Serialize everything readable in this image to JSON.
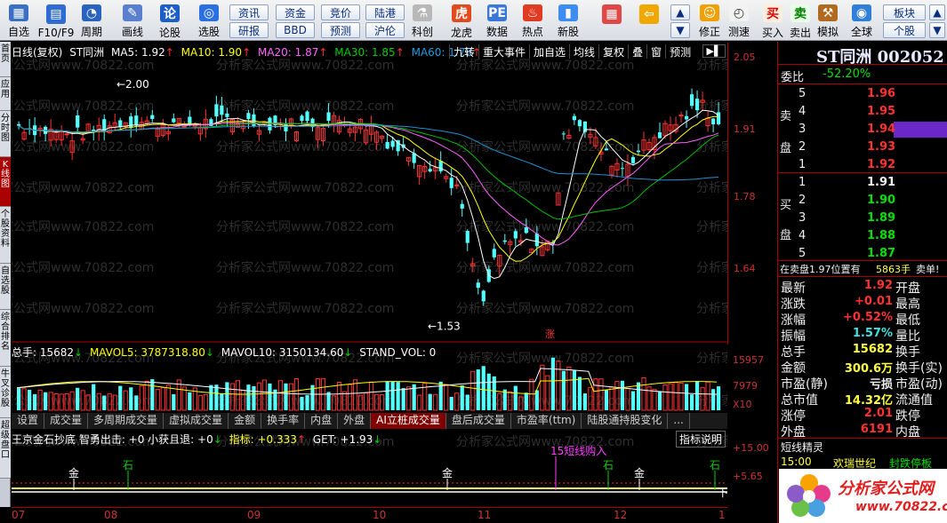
{
  "toolbar": {
    "left_items": [
      {
        "label": "自选",
        "icon": "grid-icon"
      },
      {
        "label": "F10/F9",
        "icon": "table-icon"
      },
      {
        "label": "周期",
        "icon": "clock-icon"
      },
      {
        "label": "画线",
        "icon": "pencil-icon"
      },
      {
        "label": "论股",
        "icon": "discuss-icon"
      },
      {
        "label": "选股",
        "icon": "compass-icon"
      }
    ],
    "text_buttons": [
      [
        "资讯",
        "研报"
      ],
      [
        "资金",
        "BBD"
      ],
      [
        "竞价",
        "预测"
      ],
      [
        "陆港",
        "沪伦"
      ]
    ],
    "mid_items": [
      {
        "label": "科创",
        "icon": "science-icon"
      },
      {
        "label": "龙虎",
        "icon": "tiger-icon"
      },
      {
        "label": "数据",
        "icon": "pe-icon"
      },
      {
        "label": "热点",
        "icon": "hot-icon"
      },
      {
        "label": "新股",
        "icon": "new-stock-icon"
      }
    ],
    "right_items": [
      {
        "label": "",
        "icon": "tiles-icon"
      },
      {
        "label": "",
        "icon": "back-arrow-icon"
      },
      {
        "label": "修正",
        "icon": "smile-icon"
      },
      {
        "label": "测速",
        "icon": "speed-clock-icon"
      },
      {
        "label": "买入",
        "icon": "buy-icon",
        "glyph": "买"
      },
      {
        "label": "卖出",
        "icon": "sell-icon",
        "glyph": "卖"
      },
      {
        "label": "模拟",
        "icon": "hammer-icon"
      },
      {
        "label": "全球",
        "icon": "globe-icon"
      }
    ],
    "far_right": [
      [
        "板块",
        "个股"
      ]
    ]
  },
  "left_tabs": [
    "首页",
    "应用",
    "分时图",
    "K线图",
    "个股资料",
    "自选股",
    "综合排名",
    "牛叉诊股",
    "超级盘口"
  ],
  "chart": {
    "header": {
      "period": "日线(复权)",
      "name": "ST同洲",
      "ma5": "MA5: 1.92",
      "ma10": "MA10: 1.90",
      "ma20": "MA20: 1.87",
      "ma30": "MA30: 1.85",
      "ma60": "MA60: 1.78"
    },
    "tools": [
      "九转",
      "重大事件",
      "加自选",
      "均线",
      "复权",
      "叠",
      "窗",
      "预测"
    ],
    "price_ticks": [
      "2.05",
      "1.91",
      "1.78",
      "1.64"
    ],
    "high_label": "2.00",
    "low_label": "1.53",
    "zhang_label": "涨",
    "watermark": "分析家公式网www.70822.com"
  },
  "volume": {
    "total": "总手: 15682",
    "mavol5": "MAVOL5: 3787318.80",
    "mavol10": "MAVOL10: 3150134.60",
    "stand": "STAND_VOL: 0",
    "ticks": [
      "15957",
      "7979",
      "X10"
    ]
  },
  "subtabs": [
    "设置",
    "成交量",
    "多周期成交量",
    "虚拟成交量",
    "金额",
    "换手率",
    "内盘",
    "外盘",
    "AI立桩成交量",
    "盘后成交量",
    "市盈率(ttm)",
    "陆股通持股变化",
    "..."
  ],
  "indicator": {
    "header": "王京金石抄底 智勇出击: +0 小获且退: +0",
    "zhibiao": "指标: +0.333",
    "get": "GET: +1.93",
    "help": "指标说明",
    "ticks": [
      "+15.00",
      "+5.65"
    ],
    "signals": [
      {
        "text": "金",
        "color": "#ffffff"
      },
      {
        "text": "石",
        "color": "#00d000"
      },
      {
        "text": "金",
        "color": "#ffffff"
      },
      {
        "text": "15短线购入",
        "color": "#ff40ff"
      },
      {
        "text": "石",
        "color": "#00d000"
      },
      {
        "text": "金",
        "color": "#ffffff"
      },
      {
        "text": "石",
        "color": "#00d000"
      }
    ],
    "right_label": "下"
  },
  "dates": [
    "07",
    "08",
    "09",
    "10",
    "11",
    "12",
    "1"
  ],
  "right_panel": {
    "title": "ST同洲 002052",
    "weibi_label": "委比",
    "weibi_value": "-52.20%",
    "sell_label_top": "卖",
    "sell_label_bottom": "盘",
    "buy_label_top": "买",
    "buy_label_bottom": "盘",
    "asks": [
      {
        "level": "5",
        "price": "1.96"
      },
      {
        "level": "4",
        "price": "1.95"
      },
      {
        "level": "3",
        "price": "1.94"
      },
      {
        "level": "2",
        "price": "1.93"
      },
      {
        "level": "1",
        "price": "1.92"
      }
    ],
    "bids": [
      {
        "level": "1",
        "price": "1.91"
      },
      {
        "level": "2",
        "price": "1.90"
      },
      {
        "level": "3",
        "price": "1.89"
      },
      {
        "level": "4",
        "price": "1.88"
      },
      {
        "level": "5",
        "price": "1.87"
      }
    ],
    "sell_status": "在卖盘1.97位置有",
    "sell_qty": "5863手",
    "sell_tag": "卖单!",
    "stats": [
      {
        "l1": "最新",
        "v1": "1.92",
        "c1": "r",
        "l2": "开盘"
      },
      {
        "l1": "涨跌",
        "v1": "+0.01",
        "c1": "r",
        "l2": "最高"
      },
      {
        "l1": "涨幅",
        "v1": "+0.52%",
        "c1": "r",
        "l2": "最低"
      },
      {
        "l1": "振幅",
        "v1": "1.57%",
        "c1": "c",
        "l2": "量比"
      },
      {
        "l1": "总手",
        "v1": "15682",
        "c1": "y",
        "l2": "换手"
      },
      {
        "l1": "金额",
        "v1": "300.6万",
        "c1": "y",
        "l2": "换手(实)"
      },
      {
        "l1": "市盈(静)",
        "v1": "亏损",
        "c1": "w",
        "l2": "市盈(动)"
      },
      {
        "l1": "总市值",
        "v1": "14.32亿",
        "c1": "y",
        "l2": "流通值"
      },
      {
        "l1": "涨停",
        "v1": "2.01",
        "c1": "r",
        "l2": "跌停"
      },
      {
        "l1": "外盘",
        "v1": "6191",
        "c1": "r",
        "l2": "内盘"
      }
    ],
    "elf_title": "短线精灵",
    "elf_time": "15:00",
    "elf_name": "欢瑞世纪",
    "elf_event": "封跌停板",
    "ad_text": "分析家公式网",
    "ad_url": "www.70822.com"
  },
  "colors": {
    "up": "#ff3232",
    "down": "#54ffff",
    "ma5": "#ffffff",
    "ma10": "#ffff00",
    "ma20": "#ff60ff",
    "ma30": "#00c000",
    "ma60": "#2090d0"
  }
}
